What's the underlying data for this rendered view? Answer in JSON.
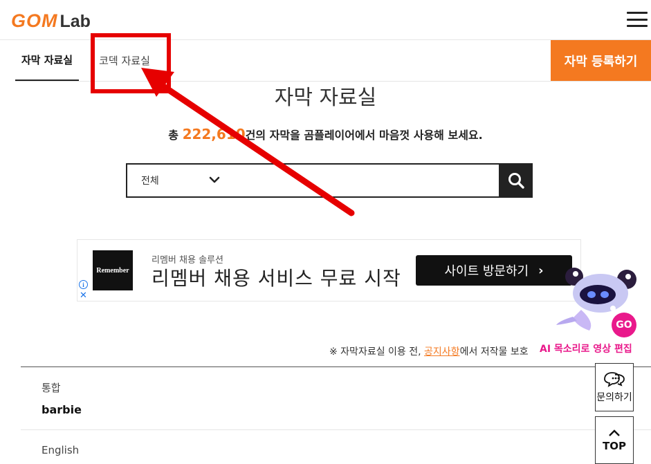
{
  "header": {
    "logo_gom": "GOM",
    "logo_lab": "Lab"
  },
  "tabs": [
    {
      "label": "자막 자료실",
      "active": true
    },
    {
      "label": "코덱 자료실",
      "active": false
    }
  ],
  "register_button": "자막 등록하기",
  "page_title": "자막 자료실",
  "total": {
    "prefix": "총 ",
    "count": "222,610",
    "suffix": "건의 자막을 곰플레이어에서 마음껏 사용해 보세요."
  },
  "search": {
    "category": "전체",
    "placeholder": ""
  },
  "ad": {
    "logo_text": "Remember",
    "subtitle": "리멤버 채용 솔루션",
    "headline": "리멤버 채용 서비스 무료 시작",
    "button": "사이트 방문하기",
    "info": "i",
    "close": "✕"
  },
  "notice": {
    "prefix": "※ 자막자료실 이용 전, ",
    "link": "공지사항",
    "suffix": "에서 저작물 보호"
  },
  "list": [
    {
      "category": "통합",
      "title": "barbie"
    },
    {
      "category": "English",
      "title": ""
    }
  ],
  "promo": {
    "text": "AI 목소리로 영상 편집",
    "badge": "GO"
  },
  "float_buttons": {
    "inquiry": "문의하기",
    "top": "TOP"
  },
  "colors": {
    "brand": "#f47920",
    "annotation": "#e60000",
    "promo": "#e9198b"
  }
}
